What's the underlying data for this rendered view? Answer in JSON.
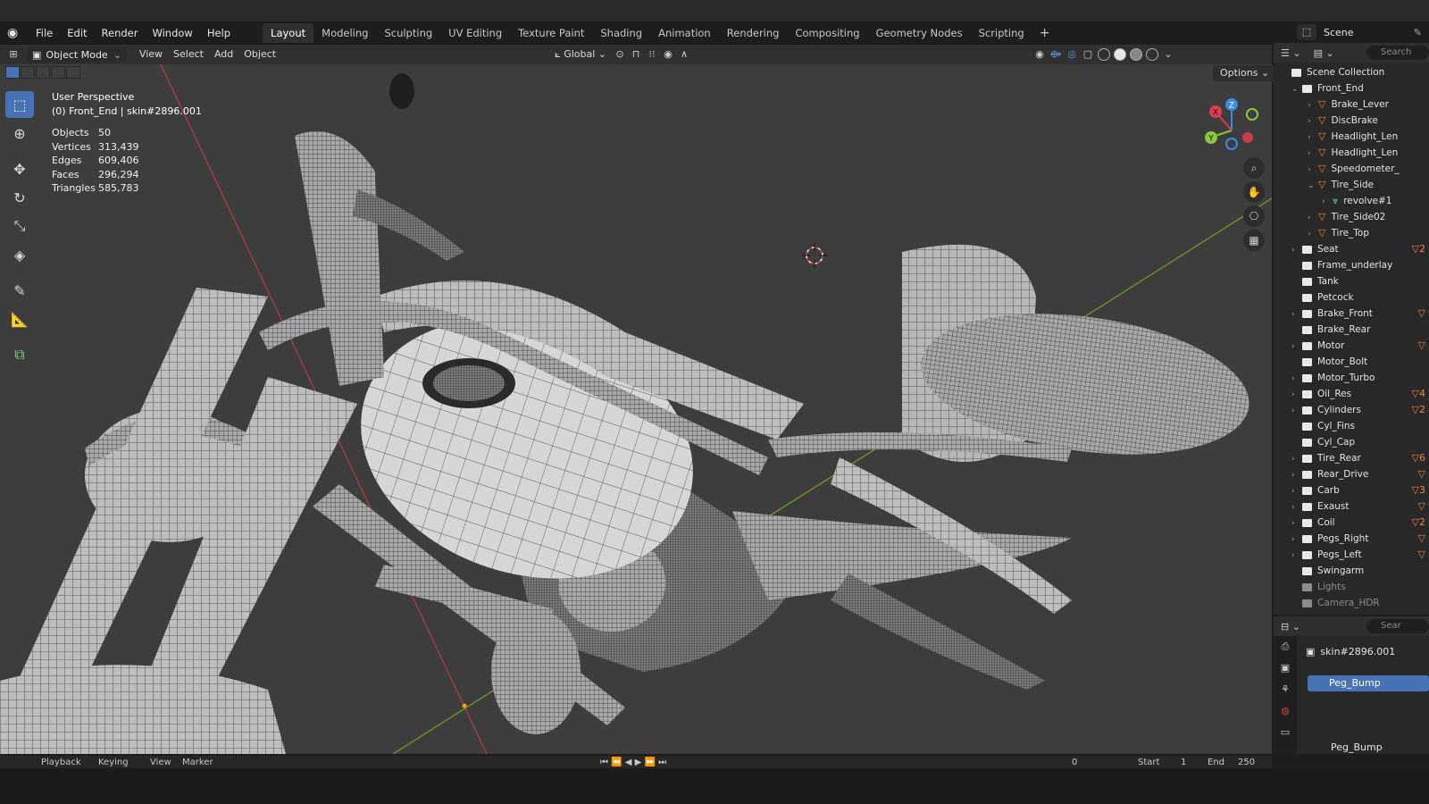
{
  "menubar": {
    "items": [
      "File",
      "Edit",
      "Render",
      "Window",
      "Help"
    ],
    "workspaces": [
      "Layout",
      "Modeling",
      "Sculpting",
      "UV Editing",
      "Texture Paint",
      "Shading",
      "Animation",
      "Rendering",
      "Compositing",
      "Geometry Nodes",
      "Scripting"
    ],
    "active_workspace": "Layout",
    "add_tab": "+"
  },
  "scene": {
    "name": "Scene"
  },
  "viewport_header": {
    "mode": "Object Mode",
    "menus": [
      "View",
      "Select",
      "Add",
      "Object"
    ],
    "orientation": "Global",
    "options": "Options"
  },
  "overlay": {
    "view_name": "User Perspective",
    "context": "(0) Front_End | skin#2896.001",
    "stats": [
      {
        "label": "Objects",
        "value": "50"
      },
      {
        "label": "Vertices",
        "value": "313,439"
      },
      {
        "label": "Edges",
        "value": "609,406"
      },
      {
        "label": "Faces",
        "value": "296,294"
      },
      {
        "label": "Triangles",
        "value": "585,783"
      }
    ]
  },
  "gizmo": {
    "x": "X",
    "y": "Y",
    "z": "Z"
  },
  "outliner": {
    "search_placeholder": "Search",
    "rows": [
      {
        "label": "Scene Collection",
        "type": "root",
        "indent": 0,
        "arrow": ""
      },
      {
        "label": "Front_End",
        "type": "coll",
        "indent": 1,
        "arrow": "⌄"
      },
      {
        "label": "Brake_Lever",
        "type": "mesh",
        "indent": 2,
        "arrow": "›"
      },
      {
        "label": "DiscBrake",
        "type": "mesh",
        "indent": 2,
        "arrow": "›"
      },
      {
        "label": "Headlight_Len",
        "type": "mesh",
        "indent": 2,
        "arrow": "›"
      },
      {
        "label": "Headlight_Len",
        "type": "mesh",
        "indent": 2,
        "arrow": "›"
      },
      {
        "label": "Speedometer_",
        "type": "mesh",
        "indent": 2,
        "arrow": "›"
      },
      {
        "label": "Tire_Side",
        "type": "mesh",
        "indent": 2,
        "arrow": "⌄"
      },
      {
        "label": "revolve#1",
        "type": "curve",
        "indent": 3,
        "arrow": "›"
      },
      {
        "label": "Tire_Side02",
        "type": "mesh",
        "indent": 2,
        "arrow": "›"
      },
      {
        "label": "Tire_Top",
        "type": "mesh",
        "indent": 2,
        "arrow": "›"
      },
      {
        "label": "Seat",
        "type": "coll",
        "indent": 1,
        "arrow": "›",
        "badge": "▽2"
      },
      {
        "label": "Frame_underlay",
        "type": "coll",
        "indent": 1,
        "arrow": ""
      },
      {
        "label": "Tank",
        "type": "coll",
        "indent": 1,
        "arrow": ""
      },
      {
        "label": "Petcock",
        "type": "coll",
        "indent": 1,
        "arrow": ""
      },
      {
        "label": "Brake_Front",
        "type": "coll",
        "indent": 1,
        "arrow": "›",
        "badge": "▽"
      },
      {
        "label": "Brake_Rear",
        "type": "coll",
        "indent": 1,
        "arrow": ""
      },
      {
        "label": "Motor",
        "type": "coll",
        "indent": 1,
        "arrow": "›",
        "badge": "▽"
      },
      {
        "label": "Motor_Bolt",
        "type": "coll",
        "indent": 1,
        "arrow": ""
      },
      {
        "label": "Motor_Turbo",
        "type": "coll",
        "indent": 1,
        "arrow": "›"
      },
      {
        "label": "Oil_Res",
        "type": "coll",
        "indent": 1,
        "arrow": "›",
        "badge": "▽4"
      },
      {
        "label": "Cylinders",
        "type": "coll",
        "indent": 1,
        "arrow": "›",
        "badge": "▽2"
      },
      {
        "label": "Cyl_Fins",
        "type": "coll",
        "indent": 1,
        "arrow": ""
      },
      {
        "label": "Cyl_Cap",
        "type": "coll",
        "indent": 1,
        "arrow": ""
      },
      {
        "label": "Tire_Rear",
        "type": "coll",
        "indent": 1,
        "arrow": "›",
        "badge": "▽6"
      },
      {
        "label": "Rear_Drive",
        "type": "coll",
        "indent": 1,
        "arrow": "›",
        "badge": "▽"
      },
      {
        "label": "Carb",
        "type": "coll",
        "indent": 1,
        "arrow": "›",
        "badge": "▽3"
      },
      {
        "label": "Exaust",
        "type": "coll",
        "indent": 1,
        "arrow": "›",
        "badge": "▽"
      },
      {
        "label": "Coil",
        "type": "coll",
        "indent": 1,
        "arrow": "›",
        "badge": "▽2"
      },
      {
        "label": "Pegs_Right",
        "type": "coll",
        "indent": 1,
        "arrow": "›",
        "badge": "▽"
      },
      {
        "label": "Pegs_Left",
        "type": "coll",
        "indent": 1,
        "arrow": "›",
        "badge": "▽"
      },
      {
        "label": "Swingarm",
        "type": "coll",
        "indent": 1,
        "arrow": ""
      },
      {
        "label": "Lights",
        "type": "coll-dim",
        "indent": 1,
        "arrow": ""
      },
      {
        "label": "Camera_HDR",
        "type": "coll-dim",
        "indent": 1,
        "arrow": ""
      }
    ]
  },
  "properties": {
    "search_placeholder": "Sear",
    "object_name": "skin#2896.001",
    "material_slot": "Peg_Bump",
    "material_name": "Peg_Bump"
  },
  "timeline": {
    "menus": [
      "Playback",
      "Keying",
      "View",
      "Marker"
    ],
    "frame": "0",
    "start_label": "Start",
    "start_value": "1",
    "end_label": "End",
    "end_value": "250"
  },
  "colors": {
    "accent": "#4772b3",
    "axis_x": "#e23b4f",
    "axis_y": "#88c93a",
    "axis_z": "#3a8be2",
    "viewport_bg": "#3d3d3d"
  }
}
